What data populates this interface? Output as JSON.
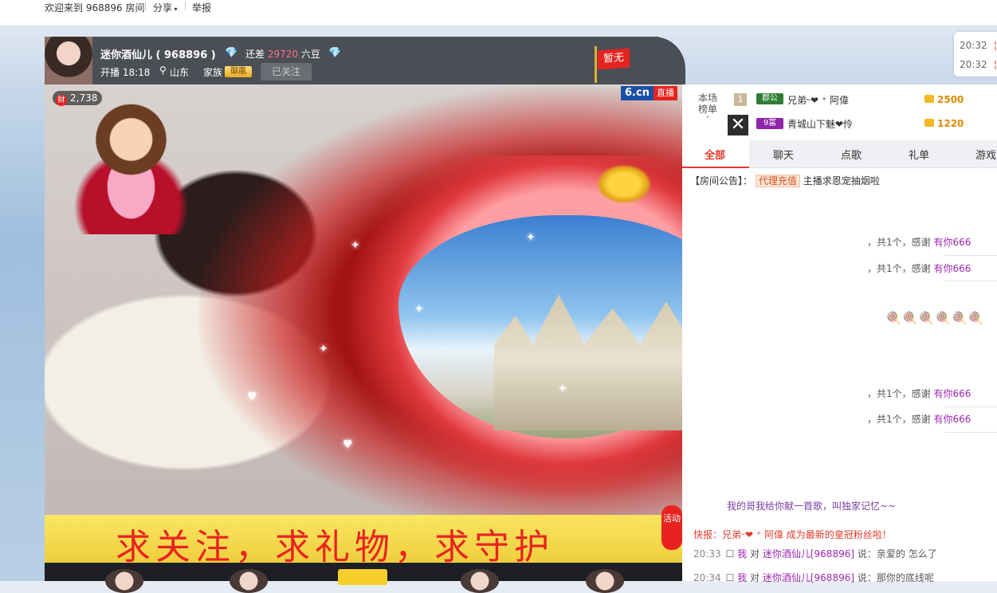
{
  "topbar": {
    "welcome": "欢迎来到 968896 房间",
    "share": "分享",
    "report": "举报"
  },
  "anchor": {
    "name": "迷你酒仙儿 ( 968896 )",
    "short_label": "还差",
    "beans": "29720",
    "beans_unit": "六豆",
    "live_time": "开播 18:18",
    "location": "山东",
    "family_label": "家族",
    "family_badge": "御凰",
    "follow_button": "已关注",
    "flag": "暂无"
  },
  "video": {
    "wealth": "2,738",
    "wealth_icon": "财",
    "logo_6cn": "6.cn",
    "logo_live": "直播",
    "banner_text": "求关注，求礼物，求守护",
    "activity_tag": "活动"
  },
  "ranking": {
    "label_line1": "本场",
    "label_line2": "榜单",
    "rows": [
      {
        "rank": "1",
        "badge": "郡公",
        "badge_color": "#2e7d32",
        "user": "兄弟ᵕ❤ ⁺ 阿偉",
        "gold": "2500"
      },
      {
        "rank": "",
        "badge": "9富",
        "badge_color": "#8e24aa",
        "user": "青城山下魅❤伶",
        "gold": "1220"
      }
    ]
  },
  "tabs": [
    "全部",
    "聊天",
    "点歌",
    "礼单",
    "游戏"
  ],
  "chat": {
    "notice_prefix": "【房间公告】：",
    "notice_chip": "代理充值",
    "notice_text": "主播求恩宠抽烟啦",
    "fragment_lines": [
      {
        "text": "，共1个，感谢",
        "user": "有你666"
      },
      {
        "text": "，共1个，感谢",
        "user": "有你666"
      },
      {
        "text": "，共1个，感谢",
        "user": "有你666"
      },
      {
        "text": "，共1个，感谢",
        "user": "有你666"
      }
    ],
    "song_msg": "我的哥我给你献一首歌，叫独家记忆~~",
    "flash": "快报：兄弟ᵕ❤ ⁺ 阿偉 成为最新的皇冠粉丝啦！",
    "bottom": [
      {
        "time": "20:33",
        "me": "我",
        "pre": "对",
        "user": "迷你酒仙儿[968896]",
        "msg": "说：亲爱的 怎么了"
      },
      {
        "time": "20:34",
        "me": "我",
        "pre": "对",
        "user": "迷你酒仙儿[968896]",
        "msg": "说：那你的底线呢"
      }
    ]
  },
  "side_times": [
    {
      "time": "20:32",
      "mark": "¦"
    },
    {
      "time": "20:32",
      "mark": "¦"
    }
  ]
}
